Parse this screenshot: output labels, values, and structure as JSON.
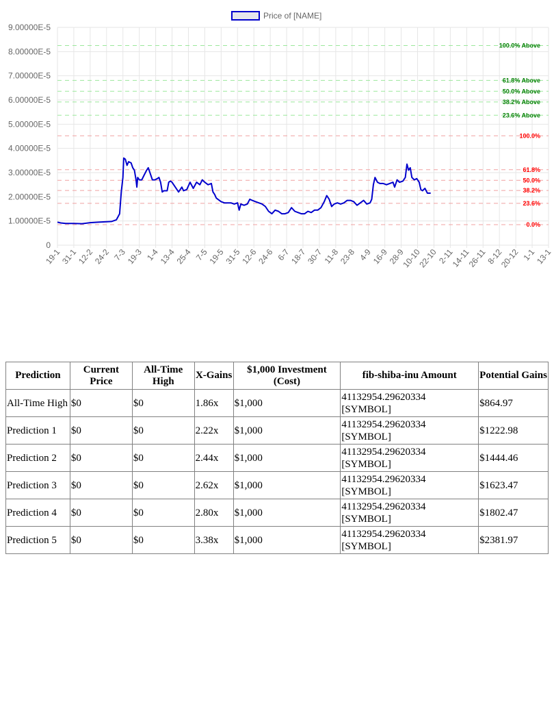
{
  "chart_data": {
    "type": "line",
    "legend": {
      "label": "Price of [NAME]",
      "position": "top-center"
    },
    "y_axis": {
      "ticks": [
        "9.00000E-5",
        "8.00000E-5",
        "7.00000E-5",
        "6.00000E-5",
        "5.00000E-5",
        "4.00000E-5",
        "3.00000E-5",
        "2.00000E-5",
        "1.00000E-5",
        "0"
      ],
      "min": 0,
      "max": 9e-05
    },
    "x_axis": {
      "ticks": [
        "19-1",
        "31-1",
        "12-2",
        "24-2",
        "7-3",
        "19-3",
        "1-4",
        "13-4",
        "25-4",
        "7-5",
        "19-5",
        "31-5",
        "12-6",
        "24-6",
        "6-7",
        "18-7",
        "30-7",
        "11-8",
        "23-8",
        "4-9",
        "16-9",
        "28-9",
        "10-10",
        "22-10",
        "2-11",
        "14-11",
        "26-11",
        "8-12",
        "20-12",
        "1-1",
        "13-1"
      ]
    },
    "grid": true,
    "series": [
      {
        "name": "Price of [NAME]",
        "color": "#0000cc",
        "points": [
          [
            0,
            9.5e-06
          ],
          [
            0.2,
            9.2e-06
          ],
          [
            0.5,
            9e-06
          ],
          [
            1,
            9e-06
          ],
          [
            1.5,
            8.9e-06
          ],
          [
            2,
            9.3e-06
          ],
          [
            2.5,
            9.5e-06
          ],
          [
            3,
            9.7e-06
          ],
          [
            3.3,
            9.8e-06
          ],
          [
            3.6,
            1.05e-05
          ],
          [
            3.8,
            1.3e-05
          ],
          [
            3.9,
            2.2e-05
          ],
          [
            4,
            2.8e-05
          ],
          [
            4.05,
            3.6e-05
          ],
          [
            4.15,
            3.55e-05
          ],
          [
            4.25,
            3.3e-05
          ],
          [
            4.35,
            3.45e-05
          ],
          [
            4.5,
            3.4e-05
          ],
          [
            4.6,
            3.2e-05
          ],
          [
            4.7,
            3.1e-05
          ],
          [
            4.8,
            2.7e-05
          ],
          [
            4.85,
            2.4e-05
          ],
          [
            4.9,
            2.8e-05
          ],
          [
            5,
            2.7e-05
          ],
          [
            5.15,
            2.7e-05
          ],
          [
            5.3,
            2.9e-05
          ],
          [
            5.45,
            3.1e-05
          ],
          [
            5.55,
            3.2e-05
          ],
          [
            5.7,
            2.9e-05
          ],
          [
            5.8,
            2.7e-05
          ],
          [
            5.95,
            2.7e-05
          ],
          [
            6.1,
            2.75e-05
          ],
          [
            6.2,
            2.8e-05
          ],
          [
            6.3,
            2.6e-05
          ],
          [
            6.4,
            2.2e-05
          ],
          [
            6.5,
            2.25e-05
          ],
          [
            6.7,
            2.25e-05
          ],
          [
            6.8,
            2.6e-05
          ],
          [
            6.9,
            2.65e-05
          ],
          [
            7,
            2.6e-05
          ],
          [
            7.2,
            2.4e-05
          ],
          [
            7.4,
            2.2e-05
          ],
          [
            7.6,
            2.4e-05
          ],
          [
            7.7,
            2.25e-05
          ],
          [
            7.9,
            2.3e-05
          ],
          [
            8.1,
            2.6e-05
          ],
          [
            8.3,
            2.35e-05
          ],
          [
            8.5,
            2.6e-05
          ],
          [
            8.7,
            2.5e-05
          ],
          [
            8.85,
            2.7e-05
          ],
          [
            9,
            2.6e-05
          ],
          [
            9.2,
            2.5e-05
          ],
          [
            9.4,
            2.55e-05
          ],
          [
            9.5,
            2.2e-05
          ],
          [
            9.6,
            2.1e-05
          ],
          [
            9.7,
            1.95e-05
          ],
          [
            9.8,
            1.9e-05
          ],
          [
            10,
            1.8e-05
          ],
          [
            10.2,
            1.75e-05
          ],
          [
            10.4,
            1.75e-05
          ],
          [
            10.6,
            1.75e-05
          ],
          [
            10.8,
            1.7e-05
          ],
          [
            11,
            1.75e-05
          ],
          [
            11.1,
            1.45e-05
          ],
          [
            11.2,
            1.7e-05
          ],
          [
            11.4,
            1.65e-05
          ],
          [
            11.6,
            1.7e-05
          ],
          [
            11.75,
            1.9e-05
          ],
          [
            11.9,
            1.85e-05
          ],
          [
            12.1,
            1.8e-05
          ],
          [
            12.3,
            1.75e-05
          ],
          [
            12.5,
            1.7e-05
          ],
          [
            12.7,
            1.6e-05
          ],
          [
            12.9,
            1.4e-05
          ],
          [
            13.1,
            1.3e-05
          ],
          [
            13.3,
            1.45e-05
          ],
          [
            13.5,
            1.4e-05
          ],
          [
            13.7,
            1.3e-05
          ],
          [
            13.9,
            1.3e-05
          ],
          [
            14.1,
            1.35e-05
          ],
          [
            14.3,
            1.55e-05
          ],
          [
            14.5,
            1.4e-05
          ],
          [
            14.7,
            1.35e-05
          ],
          [
            14.9,
            1.3e-05
          ],
          [
            15.1,
            1.3e-05
          ],
          [
            15.3,
            1.4e-05
          ],
          [
            15.5,
            1.35e-05
          ],
          [
            15.7,
            1.45e-05
          ],
          [
            15.9,
            1.45e-05
          ],
          [
            16.1,
            1.55e-05
          ],
          [
            16.3,
            1.8e-05
          ],
          [
            16.45,
            2.05e-05
          ],
          [
            16.6,
            1.9e-05
          ],
          [
            16.75,
            1.6e-05
          ],
          [
            16.9,
            1.7e-05
          ],
          [
            17.1,
            1.75e-05
          ],
          [
            17.3,
            1.7e-05
          ],
          [
            17.5,
            1.75e-05
          ],
          [
            17.7,
            1.85e-05
          ],
          [
            17.9,
            1.85e-05
          ],
          [
            18.1,
            1.8e-05
          ],
          [
            18.3,
            1.65e-05
          ],
          [
            18.5,
            1.75e-05
          ],
          [
            18.7,
            1.85e-05
          ],
          [
            18.9,
            1.7e-05
          ],
          [
            19.1,
            1.75e-05
          ],
          [
            19.2,
            1.9e-05
          ],
          [
            19.3,
            2.5e-05
          ],
          [
            19.4,
            2.8e-05
          ],
          [
            19.55,
            2.6e-05
          ],
          [
            19.7,
            2.55e-05
          ],
          [
            19.9,
            2.55e-05
          ],
          [
            20.1,
            2.5e-05
          ],
          [
            20.3,
            2.55e-05
          ],
          [
            20.5,
            2.6e-05
          ],
          [
            20.6,
            2.4e-05
          ],
          [
            20.75,
            2.7e-05
          ],
          [
            20.9,
            2.6e-05
          ],
          [
            21.1,
            2.65e-05
          ],
          [
            21.25,
            2.8e-05
          ],
          [
            21.35,
            3.35e-05
          ],
          [
            21.45,
            3.1e-05
          ],
          [
            21.55,
            3.2e-05
          ],
          [
            21.65,
            2.8e-05
          ],
          [
            21.8,
            2.7e-05
          ],
          [
            21.95,
            2.75e-05
          ],
          [
            22.1,
            2.6e-05
          ],
          [
            22.2,
            2.3e-05
          ],
          [
            22.3,
            2.25e-05
          ],
          [
            22.45,
            2.35e-05
          ],
          [
            22.6,
            2.15e-05
          ],
          [
            22.8,
            2.15e-05
          ]
        ]
      }
    ],
    "fib_levels": [
      {
        "label": "100.0% Above",
        "value": 8.25e-05,
        "color": "#008000",
        "line": "#9be89b"
      },
      {
        "label": "61.8% Above",
        "value": 6.81e-05,
        "color": "#008000",
        "line": "#9be89b"
      },
      {
        "label": "50.0% Above",
        "value": 6.36e-05,
        "color": "#008000",
        "line": "#9be89b"
      },
      {
        "label": "38.2% Above",
        "value": 5.92e-05,
        "color": "#008000",
        "line": "#9be89b"
      },
      {
        "label": "23.6% Above",
        "value": 5.37e-05,
        "color": "#008000",
        "line": "#9be89b"
      },
      {
        "label": "100.0%",
        "value": 4.52e-05,
        "color": "#ff0000",
        "line": "#f0a0a0"
      },
      {
        "label": "61.8%",
        "value": 3.12e-05,
        "color": "#ff0000",
        "line": "#f0a0a0"
      },
      {
        "label": "50.0%",
        "value": 2.68e-05,
        "color": "#ff0000",
        "line": "#f0a0a0"
      },
      {
        "label": "38.2%",
        "value": 2.26e-05,
        "color": "#ff0000",
        "line": "#f0a0a0"
      },
      {
        "label": "23.6%",
        "value": 1.73e-05,
        "color": "#ff0000",
        "line": "#f0a0a0"
      },
      {
        "label": "0.0%",
        "value": 8.5e-06,
        "color": "#ff0000",
        "line": "#f0a0a0"
      }
    ]
  },
  "table": {
    "headers": [
      "Prediction",
      "Current Price",
      "All-Time High",
      "X-Gains",
      "$1,000 Investment (Cost)",
      "fib-shiba-inu Amount",
      "Potential Gains"
    ],
    "rows": [
      [
        "All-Time High",
        "$0",
        "$0",
        "1.86x",
        "$1,000",
        "41132954.29620334 [SYMBOL]",
        "$864.97"
      ],
      [
        "Prediction 1",
        "$0",
        "$0",
        "2.22x",
        "$1,000",
        "41132954.29620334 [SYMBOL]",
        "$1222.98"
      ],
      [
        "Prediction 2",
        "$0",
        "$0",
        "2.44x",
        "$1,000",
        "41132954.29620334 [SYMBOL]",
        "$1444.46"
      ],
      [
        "Prediction 3",
        "$0",
        "$0",
        "2.62x",
        "$1,000",
        "41132954.29620334 [SYMBOL]",
        "$1623.47"
      ],
      [
        "Prediction 4",
        "$0",
        "$0",
        "2.80x",
        "$1,000",
        "41132954.29620334 [SYMBOL]",
        "$1802.47"
      ],
      [
        "Prediction 5",
        "$0",
        "$0",
        "3.38x",
        "$1,000",
        "41132954.29620334 [SYMBOL]",
        "$2381.97"
      ]
    ]
  }
}
